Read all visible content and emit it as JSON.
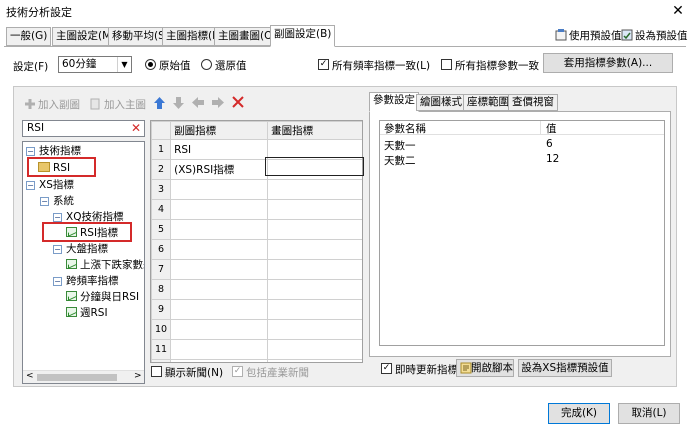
{
  "window": {
    "title": "技術分析設定",
    "close": "✕"
  },
  "tabs": [
    {
      "label": "一般(G)"
    },
    {
      "label": "主圖設定(M)"
    },
    {
      "label": "移動平均(S)"
    },
    {
      "label": "主圖指標(I)"
    },
    {
      "label": "主圖畫圖(O)"
    },
    {
      "label": "副圖設定(B)"
    }
  ],
  "top_right": {
    "use_default": "使用預設值",
    "set_default": "設為預設值"
  },
  "settings": {
    "label": "設定(F)",
    "combo_value": "60分鐘",
    "radio_original": "原始值",
    "radio_restore": "還原值",
    "check_all_freq": "所有頻率指標一致(L)",
    "check_all_params": "所有指標參數一致",
    "apply_button": "套用指標參數(A)..."
  },
  "toolbar": {
    "add_sub": "加入副圖",
    "add_main": "加入主圖"
  },
  "search": {
    "value": "RSI"
  },
  "tree": [
    {
      "label": "技術指標",
      "toggle": "−",
      "kind": "folder-root"
    },
    {
      "label": "RSI",
      "kind": "leaf-folder"
    },
    {
      "label": "XS指標",
      "toggle": "−",
      "kind": "folder-root"
    },
    {
      "label": "系統",
      "toggle": "−"
    },
    {
      "label": "XQ技術指標",
      "toggle": "−"
    },
    {
      "label": "RSI指標",
      "kind": "chart"
    },
    {
      "label": "大盤指標",
      "toggle": "−"
    },
    {
      "label": "上漲下跌家數差RSI",
      "kind": "chart"
    },
    {
      "label": "跨頻率指標",
      "toggle": "−"
    },
    {
      "label": "分鐘與日RSI",
      "kind": "chart"
    },
    {
      "label": "週RSI",
      "kind": "chart"
    }
  ],
  "grid": {
    "headers": [
      "副圖指標",
      "畫圖指標"
    ],
    "rows": [
      {
        "n": "1",
        "sub": "RSI",
        "draw": ""
      },
      {
        "n": "2",
        "sub": "(XS)RSI指標",
        "draw": ""
      },
      {
        "n": "3",
        "sub": "",
        "draw": ""
      },
      {
        "n": "4",
        "sub": "",
        "draw": ""
      },
      {
        "n": "5",
        "sub": "",
        "draw": ""
      },
      {
        "n": "6",
        "sub": "",
        "draw": ""
      },
      {
        "n": "7",
        "sub": "",
        "draw": ""
      },
      {
        "n": "8",
        "sub": "",
        "draw": ""
      },
      {
        "n": "9",
        "sub": "",
        "draw": ""
      },
      {
        "n": "10",
        "sub": "",
        "draw": ""
      },
      {
        "n": "11",
        "sub": "",
        "draw": ""
      },
      {
        "n": "12",
        "sub": "",
        "draw": ""
      }
    ]
  },
  "left_bottom": {
    "show_news": "顯示新聞(N)",
    "include_industry": "包括產業新聞"
  },
  "right_tabs": [
    {
      "label": "參數設定"
    },
    {
      "label": "繪圖樣式"
    },
    {
      "label": "座標範圍"
    },
    {
      "label": "查價視窗"
    }
  ],
  "params": {
    "headers": [
      "參數名稱",
      "值"
    ],
    "rows": [
      {
        "name": "天數一",
        "value": "6"
      },
      {
        "name": "天數二",
        "value": "12"
      }
    ]
  },
  "right_bottom": {
    "update_now": "即時更新指標",
    "open_script": "開啟腳本",
    "set_xs_default": "設為XS指標預設值"
  },
  "footer": {
    "ok": "完成(K)",
    "cancel": "取消(L)"
  },
  "colors": {
    "accent": "#d42a2a",
    "blue_arrow": "#3b78d4"
  }
}
